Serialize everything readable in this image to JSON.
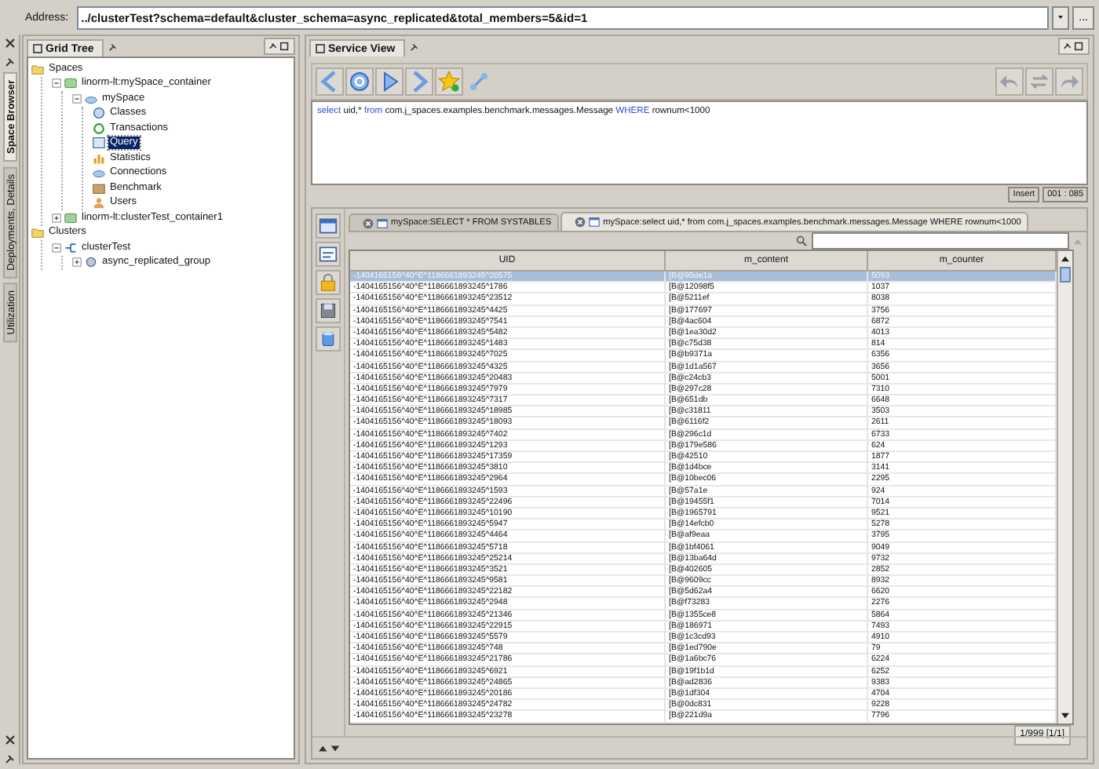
{
  "address": {
    "label": "Address:",
    "value": "../clusterTest?schema=default&cluster_schema=async_replicated&total_members=5&id=1",
    "more_button": "..."
  },
  "side_tabs": [
    {
      "label": "Space Browser",
      "selected": true
    },
    {
      "label": "Deployments, Details",
      "selected": false
    },
    {
      "label": "Utilization",
      "selected": false
    }
  ],
  "grid_tree": {
    "title": "Grid Tree",
    "nodes": [
      {
        "label": "Spaces",
        "kind": "folder",
        "selected": false,
        "children": [
          {
            "label": "linorm-lt:mySpace_container",
            "kind": "container",
            "expanded": true,
            "selected": false,
            "children": [
              {
                "label": "mySpace",
                "kind": "space",
                "expanded": true,
                "selected": false,
                "children": [
                  {
                    "label": "Classes",
                    "kind": "classes",
                    "selected": false
                  },
                  {
                    "label": "Transactions",
                    "kind": "transactions",
                    "selected": false
                  },
                  {
                    "label": "Query",
                    "kind": "query",
                    "selected": true
                  },
                  {
                    "label": "Statistics",
                    "kind": "statistics",
                    "selected": false
                  },
                  {
                    "label": "Connections",
                    "kind": "connections",
                    "selected": false
                  },
                  {
                    "label": "Benchmark",
                    "kind": "benchmark",
                    "selected": false
                  },
                  {
                    "label": "Users",
                    "kind": "users",
                    "selected": false
                  }
                ]
              }
            ]
          },
          {
            "label": "linorm-lt:clusterTest_container1",
            "kind": "container",
            "expanded": false,
            "selected": false
          }
        ]
      },
      {
        "label": "Clusters",
        "kind": "folder",
        "selected": false,
        "children": [
          {
            "label": "clusterTest",
            "kind": "cluster",
            "expanded": true,
            "selected": false,
            "children": [
              {
                "label": "async_replicated_group",
                "kind": "group",
                "expanded": false,
                "selected": false
              }
            ]
          }
        ]
      }
    ]
  },
  "service_view": {
    "title": "Service View",
    "query": [
      {
        "text": "select",
        "kind": "keyword"
      },
      {
        "text": " uid,* ",
        "kind": "plain"
      },
      {
        "text": "from",
        "kind": "keyword"
      },
      {
        "text": " com.j_spaces.examples.benchmark.messages.Message ",
        "kind": "plain"
      },
      {
        "text": "WHERE",
        "kind": "keyword"
      },
      {
        "text": " rownum<1000",
        "kind": "plain"
      }
    ],
    "editor_mode": "Insert",
    "cursor_position": "001 : 085",
    "result_tabs": [
      {
        "label": "mySpace:SELECT * FROM SYSTABLES",
        "selected": false
      },
      {
        "label": "mySpace:select uid,* from com.j_spaces.examples.benchmark.messages.Message WHERE rownum<1000",
        "selected": true
      }
    ],
    "table": {
      "columns": [
        "UID",
        "m_content",
        "m_counter"
      ],
      "rows": [
        {
          "cells": [
            "-1404165156^40^E^1186661893245^20575",
            "[B@95de1a",
            "5093"
          ],
          "selected": true
        },
        {
          "cells": [
            "-1404165156^40^E^1186661893245^1786",
            "[B@12098f5",
            "1037"
          ],
          "selected": false
        },
        {
          "cells": [
            "-1404165156^40^E^1186661893245^23512",
            "[B@5211ef",
            "8038"
          ],
          "selected": false
        },
        {
          "cells": [
            "-1404165156^40^E^1186661893245^4425",
            "[B@177697",
            "3756"
          ],
          "selected": false
        },
        {
          "cells": [
            "-1404165156^40^E^1186661893245^7541",
            "[B@4ac604",
            "6872"
          ],
          "selected": false
        },
        {
          "cells": [
            "-1404165156^40^E^1186661893245^5482",
            "[B@1ea30d2",
            "4013"
          ],
          "selected": false
        },
        {
          "cells": [
            "-1404165156^40^E^1186661893245^1483",
            "[B@c75d38",
            "814"
          ],
          "selected": false
        },
        {
          "cells": [
            "-1404165156^40^E^1186661893245^7025",
            "[B@b9371a",
            "6356"
          ],
          "selected": false
        },
        {
          "cells": [
            "-1404165156^40^E^1186661893245^4325",
            "[B@1d1a567",
            "3656"
          ],
          "selected": false
        },
        {
          "cells": [
            "-1404165156^40^E^1186661893245^20483",
            "[B@c24cb3",
            "5001"
          ],
          "selected": false
        },
        {
          "cells": [
            "-1404165156^40^E^1186661893245^7979",
            "[B@297c28",
            "7310"
          ],
          "selected": false
        },
        {
          "cells": [
            "-1404165156^40^E^1186661893245^7317",
            "[B@651db",
            "6648"
          ],
          "selected": false
        },
        {
          "cells": [
            "-1404165156^40^E^1186661893245^18985",
            "[B@c31811",
            "3503"
          ],
          "selected": false
        },
        {
          "cells": [
            "-1404165156^40^E^1186661893245^18093",
            "[B@6116f2",
            "2611"
          ],
          "selected": false
        },
        {
          "cells": [
            "-1404165156^40^E^1186661893245^7402",
            "[B@296c1d",
            "6733"
          ],
          "selected": false
        },
        {
          "cells": [
            "-1404165156^40^E^1186661893245^1293",
            "[B@179e586",
            "624"
          ],
          "selected": false
        },
        {
          "cells": [
            "-1404165156^40^E^1186661893245^17359",
            "[B@42510",
            "1877"
          ],
          "selected": false
        },
        {
          "cells": [
            "-1404165156^40^E^1186661893245^3810",
            "[B@1d4bce",
            "3141"
          ],
          "selected": false
        },
        {
          "cells": [
            "-1404165156^40^E^1186661893245^2964",
            "[B@10bec06",
            "2295"
          ],
          "selected": false
        },
        {
          "cells": [
            "-1404165156^40^E^1186661893245^1593",
            "[B@57a1e",
            "924"
          ],
          "selected": false
        },
        {
          "cells": [
            "-1404165156^40^E^1186661893245^22496",
            "[B@19455f1",
            "7014"
          ],
          "selected": false
        },
        {
          "cells": [
            "-1404165156^40^E^1186661893245^10190",
            "[B@1965791",
            "9521"
          ],
          "selected": false
        },
        {
          "cells": [
            "-1404165156^40^E^1186661893245^5947",
            "[B@14efcb0",
            "5278"
          ],
          "selected": false
        },
        {
          "cells": [
            "-1404165156^40^E^1186661893245^4464",
            "[B@af9eaa",
            "3795"
          ],
          "selected": false
        },
        {
          "cells": [
            "-1404165156^40^E^1186661893245^5718",
            "[B@1bf4061",
            "9049"
          ],
          "selected": false
        },
        {
          "cells": [
            "-1404165156^40^E^1186661893245^25214",
            "[B@13ba64d",
            "9732"
          ],
          "selected": false
        },
        {
          "cells": [
            "-1404165156^40^E^1186661893245^3521",
            "[B@402605",
            "2852"
          ],
          "selected": false
        },
        {
          "cells": [
            "-1404165156^40^E^1186661893245^9581",
            "[B@9609cc",
            "8932"
          ],
          "selected": false
        },
        {
          "cells": [
            "-1404165156^40^E^1186661893245^22182",
            "[B@5d62a4",
            "6620"
          ],
          "selected": false
        },
        {
          "cells": [
            "-1404165156^40^E^1186661893245^2948",
            "[B@f73283",
            "2276"
          ],
          "selected": false
        },
        {
          "cells": [
            "-1404165156^40^E^1186661893245^21346",
            "[B@1355ce8",
            "5864"
          ],
          "selected": false
        },
        {
          "cells": [
            "-1404165156^40^E^1186661893245^22915",
            "[B@186971",
            "7493"
          ],
          "selected": false
        },
        {
          "cells": [
            "-1404165156^40^E^1186661893245^5579",
            "[B@1c3cd93",
            "4910"
          ],
          "selected": false
        },
        {
          "cells": [
            "-1404165156^40^E^1186661893245^748",
            "[B@1ed790e",
            "79"
          ],
          "selected": false
        },
        {
          "cells": [
            "-1404165156^40^E^1186661893245^21786",
            "[B@1a6bc76",
            "6224"
          ],
          "selected": false
        },
        {
          "cells": [
            "-1404165156^40^E^1186661893245^6921",
            "[B@19f1b1d",
            "6252"
          ],
          "selected": false
        },
        {
          "cells": [
            "-1404165156^40^E^1186661893245^24865",
            "[B@ad2836",
            "9383"
          ],
          "selected": false
        },
        {
          "cells": [
            "-1404165156^40^E^1186661893245^20186",
            "[B@1df304",
            "4704"
          ],
          "selected": false
        },
        {
          "cells": [
            "-1404165156^40^E^1186661893245^24782",
            "[B@0dc831",
            "9228"
          ],
          "selected": false
        },
        {
          "cells": [
            "-1404165156^40^E^1186661893245^23278",
            "[B@221d9a",
            "7796"
          ],
          "selected": false
        }
      ]
    },
    "row_count": "1/999 [1/1]"
  }
}
